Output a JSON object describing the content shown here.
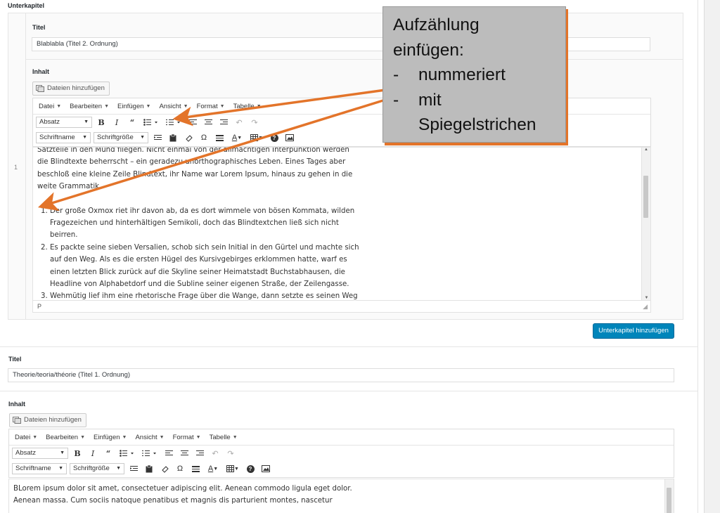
{
  "section1": {
    "header": "Unterkapitel",
    "title_label": "Titel",
    "title_value": "Blablabla (Titel 2. Ordnung)",
    "content_label": "Inhalt",
    "add_files": "Dateien hinzufügen",
    "line_number": "1",
    "editor": {
      "para": "Satzteile in den Mund fliegen. Nicht einmal von der allmächtigen Interpunktion werden die Blindtexte beherrscht – ein geradezu unorthographisches Leben. Eines Tages aber beschloß eine kleine Zeile Blindtext, ihr Name war Lorem Ipsum, hinaus zu gehen in die weite Grammatik.",
      "items": [
        "Der große Oxmox riet ihr davon ab, da es dort wimmele von bösen Kommata, wilden Fragezeichen und hinterhältigen Semikoli, doch das Blindtextchen ließ sich nicht beirren.",
        "Es packte seine sieben Versalien, schob sich sein Initial in den Gürtel und machte sich auf den Weg. Als es die ersten Hügel des Kursivgebirges erklommen hatte, warf es einen letzten Blick zurück auf die Skyline seiner Heimatstadt Buchstabhausen, die Headline von Alphabetdorf und die Subline seiner eigenen Straße, der Zeilengasse.",
        "Wehmütig lief ihm eine rhetorische Frage über die Wange, dann setzte es seinen Weg fort. Unterwegs traf es eine Copy. Die Copy warnte das Blindtextchen, da, wo sie herkäme wäre"
      ],
      "statusbar": "P"
    },
    "add_subchapter": "Unterkapitel hinzufügen"
  },
  "section2": {
    "title_label": "Titel",
    "title_value": "Theorie/teoria/théorie (Titel 1. Ordnung)",
    "content_label": "Inhalt",
    "add_files": "Dateien hinzufügen",
    "editor_lines": [
      "BLorem ipsum dolor sit amet, consectetuer adipiscing elit. Aenean commodo ligula eget dolor.",
      "Aenean massa. Cum sociis natoque penatibus et magnis dis parturient montes, nascetur"
    ]
  },
  "toolbar": {
    "menus": [
      "Datei",
      "Bearbeiten",
      "Einfügen",
      "Ansicht",
      "Format",
      "Tabelle"
    ],
    "paragraph": "Absatz",
    "font_name": "Schriftname",
    "font_size": "Schriftgröße",
    "bold": "B",
    "italic": "I",
    "quote": "“",
    "omega": "Ω",
    "font_color": "A",
    "help": "?"
  },
  "callout": {
    "line1": "Aufzählung",
    "line2": "einfügen:",
    "dash": "-",
    "item1": "nummeriert",
    "item2": "mit",
    "item3": "Spiegelstrichen"
  },
  "colors": {
    "primary": "#0085ba",
    "arrow": "#e3742a",
    "callout_bg": "#bcbcbc"
  }
}
